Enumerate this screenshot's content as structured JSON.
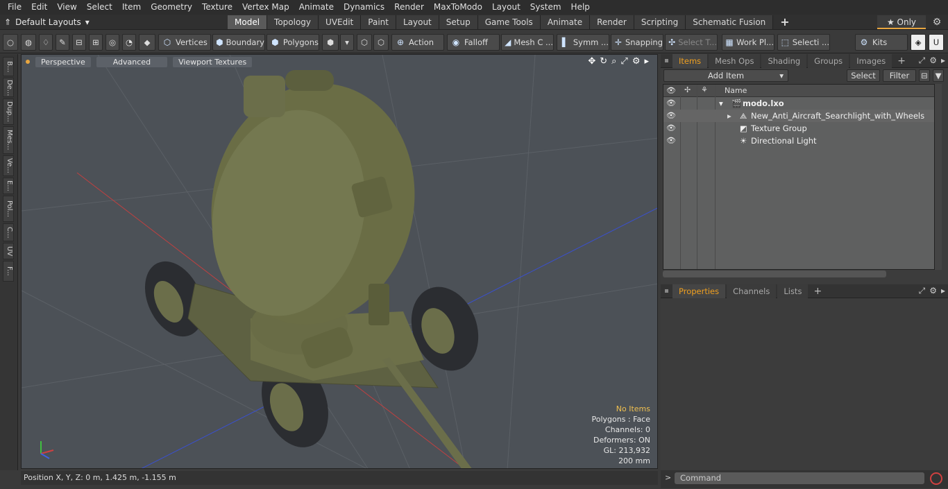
{
  "menu": [
    "File",
    "Edit",
    "View",
    "Select",
    "Item",
    "Geometry",
    "Texture",
    "Vertex Map",
    "Animate",
    "Dynamics",
    "Render",
    "MaxToModo",
    "Layout",
    "System",
    "Help"
  ],
  "layouts_label": "Default Layouts",
  "tabs": [
    "Model",
    "Topology",
    "UVEdit",
    "Paint",
    "Layout",
    "Setup",
    "Game Tools",
    "Animate",
    "Render",
    "Scripting",
    "Schematic Fusion"
  ],
  "only_label": "Only",
  "toolbar": {
    "vertices": "Vertices",
    "boundary": "Boundary",
    "polygons": "Polygons",
    "action": "Action",
    "falloff": "Falloff",
    "mesh": "Mesh C ...",
    "symm": "Symm ...",
    "snapping": "Snapping",
    "selectt": "Select T...",
    "workpl": "Work Pl...",
    "selecti": "Selecti ...",
    "kits": "Kits"
  },
  "left_tabs": [
    "B...",
    "De...",
    "Dup...",
    "Mes...",
    "Ve...",
    "E...",
    "Pol...",
    "C...",
    "UV",
    "F..."
  ],
  "viewport": {
    "perspective": "Perspective",
    "advanced": "Advanced",
    "textures": "Viewport Textures",
    "info": {
      "no_items": "No Items",
      "polygons": "Polygons : Face",
      "channels": "Channels: 0",
      "deformers": "Deformers: ON",
      "gl": "GL: 213,932",
      "size": "200 mm"
    }
  },
  "status": "Position X, Y, Z:   0 m, 1.425 m, -1.155 m",
  "items_panel": {
    "tabs": [
      "Items",
      "Mesh Ops",
      "Shading",
      "Groups",
      "Images"
    ],
    "add_item": "Add Item",
    "select": "Select",
    "filter": "Filter",
    "col_name": "Name",
    "rows": [
      {
        "label": "modo.lxo"
      },
      {
        "label": "New_Anti_Aircraft_Searchlight_with_Wheels"
      },
      {
        "label": "Texture Group"
      },
      {
        "label": "Directional Light"
      }
    ]
  },
  "props_panel": {
    "tabs": [
      "Properties",
      "Channels",
      "Lists"
    ]
  },
  "command_placeholder": "Command",
  "colors": {
    "accent": "#f0a020",
    "model_green": "#6b6e4a",
    "viewport_bg": "#4c5157"
  }
}
